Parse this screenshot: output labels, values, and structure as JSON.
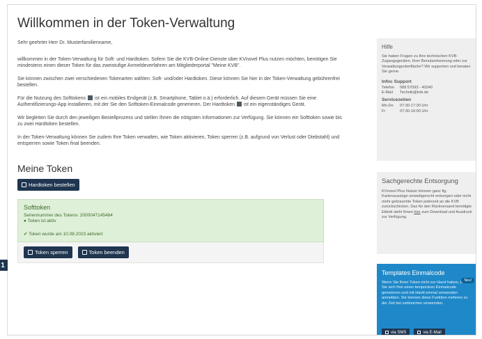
{
  "main": {
    "title": "Willkommen in der Token-Verwaltung",
    "salutation": "Sehr geehrter Herr Dr. Musterfamilienname,",
    "para1": "willkommen in der Token-Verwaltung für Soft- und Hardtoken. Sofern Sie die KVB-Online-Dienste über KVnovel Plus nutzen möchten, benötigen Sie mindestens einen dieser Token für das zweistufige Anmeldeverfahren am Mitgliederportal \"Meine KVB\".",
    "para2": "Sie können zwischen zwei verschiedenen Tokenarten wählen: Soft- und/oder Hardtoken. Diese können Sie hier in der Token-Verwaltung gebührenfrei bestellen.",
    "para3a": "Für die Nutzung des Softtokens",
    "para3b": "ist ein mobiles Endgerät (z.B. Smartphone, Tablet o.ä.) erforderlich. Auf diesem Gerät müssen Sie eine Authentifizierungs-App installieren, mit der Sie den Softtoken-Einmalcode generieren. Der Hardtoken",
    "para3c": "ist ein eigenständiges Gerät.",
    "para4": "Wir begleiten Sie durch den jeweiligen Bestellprozess und stellen Ihnen die nötigsten Informationen zur Verfügung. Sie können ein Softtoken sowie bis zu zwei Hardtoken bestellen.",
    "para5": "In der Token-Verwaltung können Sie zudem Ihre Token verwalten, wie Token aktivieren, Token sperren (z.B. aufgrund von Verlust oder Diebstahl) und entsperren sowie Token final beenden.",
    "section_title": "Meine Token",
    "order_button": "Hardtoken bestellen",
    "marker": "1",
    "card": {
      "title": "Softtoken",
      "serial": "Seriennummer des Tokens: 2000047145484",
      "status": "Token ist aktiv",
      "created": "Token wurde am 10.08.2023 aktiviert",
      "lock_button": "Token sperren",
      "end_button": "Token beenden"
    }
  },
  "sidebar": {
    "help": {
      "title": "Hilfe",
      "text": "Sie haben Fragen zu Ihre technischen KVB-Zugangsgeräten. Ihrer Benutzerkennung oder zur Verwaltungsoberfläche? Wir supporten und beraten Sie gerne.",
      "support_title": "Infoc Support",
      "phone_label": "Telefon",
      "phone": "089 57093 - 40240",
      "mail_label": "E-Mail",
      "mail": "Technik@kvb.de",
      "hours_title": "Servicezeiten",
      "days1": "Mo-Do",
      "hours1": "07:30-17:30 Uhr",
      "days2": "Fr",
      "hours2": "07:30-16:00 Uhr"
    },
    "dispose": {
      "title": "Sachgerechte Entsorgung",
      "text_a": "KVnovel Plus Nutzer können ganz fig. Kartenauszüge umweltgerecht entsorgen oder nicht mehr gebrauchte Token jederzeit an die KVB zurückschicken. Das für den Rückversand benötigte Etikett steht Ihnen",
      "link": "hier",
      "text_b": "zum Download und Ausdruck zur Verfügung."
    },
    "promo": {
      "title": "Templates Einmalcode",
      "badge": "Neu!",
      "text": "Wenn Sie Ihren Token nicht zur Hand haben, können Sie sich Ihre einen temporären Einmalcode generieren und mit Hardt einmal verwenden anmelden. Sie können diese Funktion mehrere zu der Zeit bei zahlreichen verwenden.",
      "btn1": "via SMS",
      "btn2": "via E-Mail"
    }
  }
}
